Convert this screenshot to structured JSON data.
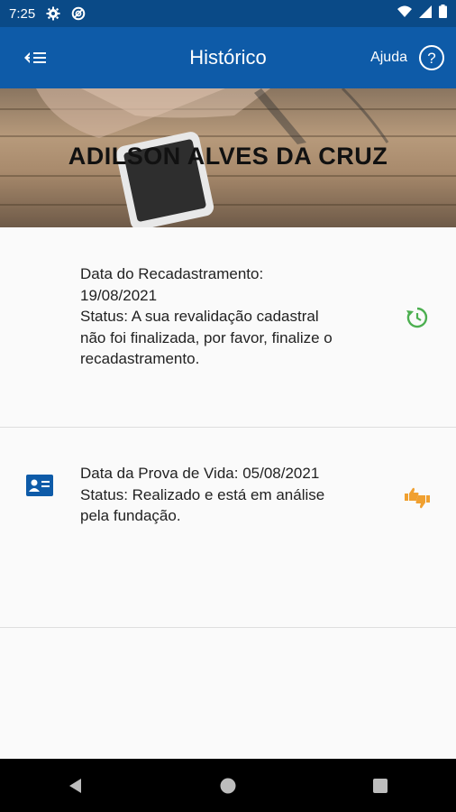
{
  "status_bar": {
    "time": "7:25",
    "icons_left": [
      "gear-icon",
      "circle-slash-icon"
    ],
    "icons_right": [
      "wifi-icon",
      "signal-icon",
      "battery-icon"
    ]
  },
  "app_bar": {
    "title": "Histórico",
    "help_label": "Ajuda",
    "back_icon": "arrow-left-icon",
    "help_icon": "question-circle-icon"
  },
  "hero": {
    "name": "ADILSON ALVES DA CRUZ"
  },
  "cards": [
    {
      "icon": "document-list-icon",
      "lines": [
        "Data do Recadastramento:",
        "19/08/2021",
        "Status: A sua revalidação cadastral",
        "não foi finalizada, por favor, finalize o",
        "recadastramento."
      ],
      "status_icon": "history-refresh-icon",
      "status_color": "#4caf50"
    },
    {
      "icon": "id-card-icon",
      "lines": [
        "Data da Prova de Vida: 05/08/2021",
        "Status: Realizado e está em análise",
        "pela fundação."
      ],
      "status_icon": "thumbs-up-down-icon",
      "status_color": "#f0a030"
    }
  ],
  "colors": {
    "status_bar": "#0a4a87",
    "app_bar": "#0e5ba8",
    "icon_blue": "#0e5ba8"
  },
  "nav_bar": {
    "buttons": [
      "back-triangle-icon",
      "home-circle-icon",
      "recents-square-icon"
    ]
  }
}
